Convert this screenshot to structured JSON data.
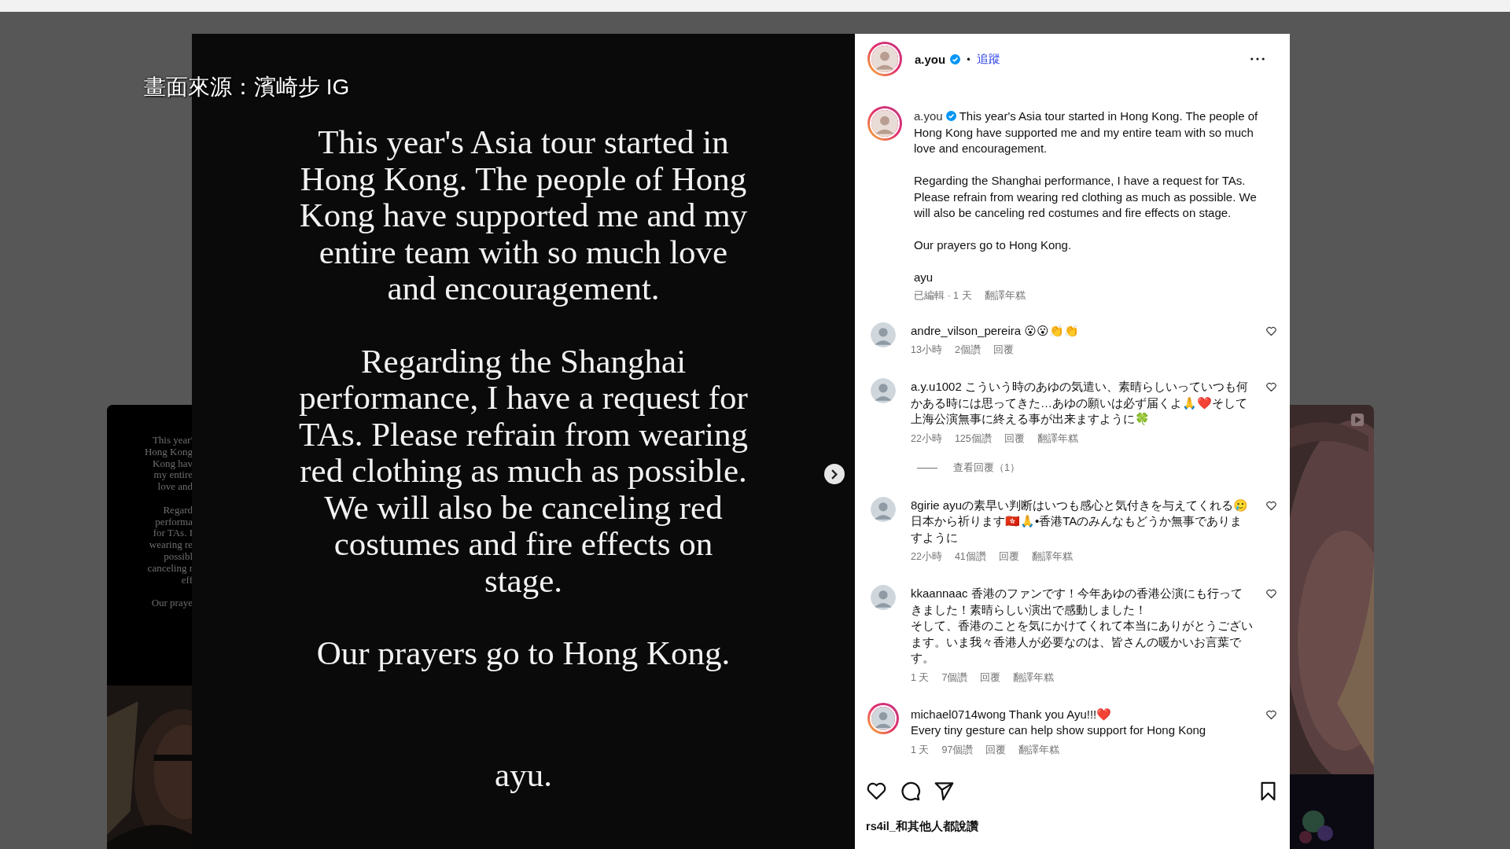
{
  "caption_overlay": "畫面來源：濱崎步 IG",
  "prev_post": {
    "paragraphs": [
      [
        "This year'",
        "Hong Kong",
        "Kong hav",
        "my entire",
        "love and"
      ],
      [
        "Regard",
        "performa",
        "for TAs. I",
        "wearing re",
        "possibl",
        "canceling r",
        "eff"
      ],
      [
        "Our praye"
      ]
    ]
  },
  "next_post": {
    "video": true
  },
  "post": {
    "paragraphs": [
      "This year's Asia tour started in Hong Kong. The people of Hong Kong have supported me and my entire team with so much love and encouragement.",
      "Regarding the Shanghai performance, I have a request for TAs. Please refrain from wearing red clothing as much as possible. We will also be canceling red costumes and fire effects on stage.",
      "Our prayers go to Hong Kong."
    ],
    "signature": "ayu."
  },
  "header": {
    "username": "a.you",
    "verified": true,
    "separator": "•",
    "follow": "追蹤",
    "story_ring": true
  },
  "caption": {
    "username": "a.you",
    "verified": true,
    "story_ring": true,
    "paragraphs": [
      "This year's Asia tour started in Hong Kong. The people of Hong Kong have supported me and my entire team with so much love and encouragement.",
      "Regarding the Shanghai performance, I have a request for TAs. Please refrain from wearing red clothing as much as possible. We will also be canceling red costumes and fire effects on stage.",
      "Our prayers go to Hong Kong.",
      "ayu"
    ],
    "edited": "已編輯 · 1 天",
    "translate": "翻譯年糕"
  },
  "comments": [
    {
      "username": "andre_vilson_pereira",
      "text": [
        "😮😮👏👏"
      ],
      "story_ring": false,
      "time": "13小時",
      "likes": "2個讚",
      "reply": "回覆"
    },
    {
      "username": "a.y.u1002",
      "text": [
        "こういう時のあゆの気遣い、素晴らしいっていつも何かある時には思ってきた…あゆの願いは必ず届くよ🙏❤️そして上海公演無事に終える事が出来ますように🍀"
      ],
      "story_ring": false,
      "time": "22小時",
      "likes": "125個讚",
      "reply": "回覆",
      "translate": "翻譯年糕",
      "view_replies": "查看回覆（1）"
    },
    {
      "username": "8girie",
      "text": [
        "ayuの素早い判断はいつも感心と気付きを与えてくれる🥲日本から祈ります🇭🇰🙏•香港TAのみんなもどうか無事でありますように"
      ],
      "story_ring": false,
      "time": "22小時",
      "likes": "41個讚",
      "reply": "回覆",
      "translate": "翻譯年糕"
    },
    {
      "username": "kkaannaac",
      "text": [
        "香港のファンです！今年あゆの香港公演にも行ってきました！素晴らしい演出で感動しました！",
        "そして、香港のことを気にかけてくれて本当にありがとうございます。いま我々香港人が必要なのは、皆さんの暖かいお言葉です。"
      ],
      "story_ring": false,
      "time": "1 天",
      "likes": "7個讚",
      "reply": "回覆",
      "translate": "翻譯年糕"
    },
    {
      "username": "michael0714wong",
      "text": [
        "Thank you Ayu!!!❤️",
        "Every tiny gesture can help show support for Hong Kong"
      ],
      "story_ring": true,
      "time": "1 天",
      "likes": "97個讚",
      "reply": "回覆",
      "translate": "翻譯年糕"
    }
  ],
  "footer": {
    "liked_by": "rs4il_和其他人都說讚"
  }
}
